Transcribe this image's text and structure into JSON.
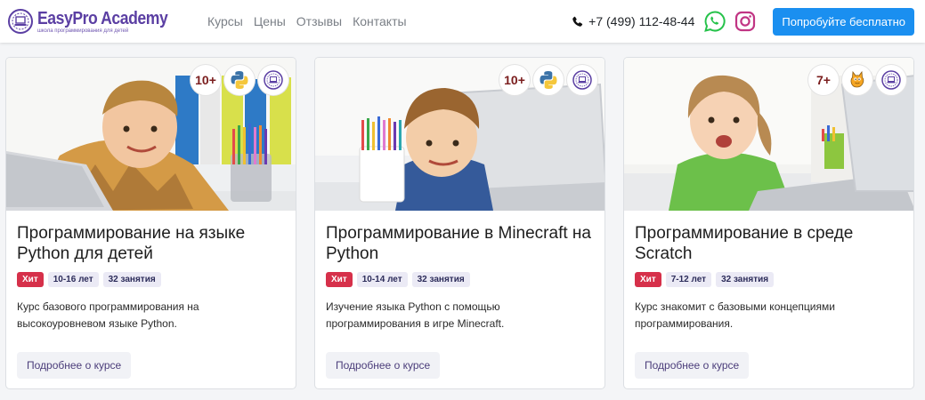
{
  "brand": {
    "name": "EasyPro Academy",
    "tagline": "школа программирования для детей"
  },
  "nav": {
    "links": [
      "Курсы",
      "Цены",
      "Отзывы",
      "Контакты"
    ]
  },
  "contact": {
    "phone": "+7 (499) 112-48-44",
    "cta_label": "Попробуйте бесплатно"
  },
  "colors": {
    "brand": "#5b3fa3",
    "cta": "#1a8ff0",
    "hit_tag": "#d6304a"
  },
  "courses": [
    {
      "age_badge": "10+",
      "lang_icon": "python-logo-icon",
      "title": "Программирование на языке Python для детей",
      "tags": [
        "Хит",
        "10-16 лет",
        "32 занятия"
      ],
      "description": "Курс базового программирования на высокоуровневом языке Python.",
      "button": "Подробнее о курсе"
    },
    {
      "age_badge": "10+",
      "lang_icon": "python-logo-icon",
      "title": "Программирование в Minecraft на Python",
      "tags": [
        "Хит",
        "10-14 лет",
        "32 занятия"
      ],
      "description": "Изучение языка Python с помощью программирования в игре Minecraft.",
      "button": "Подробнее о курсе"
    },
    {
      "age_badge": "7+",
      "lang_icon": "scratch-cat-icon",
      "title": "Программирование в среде Scratch",
      "tags": [
        "Хит",
        "7-12 лет",
        "32 занятия"
      ],
      "description": "Курс знакомит с базовыми концепциями программирования.",
      "button": "Подробнее о курсе"
    }
  ]
}
